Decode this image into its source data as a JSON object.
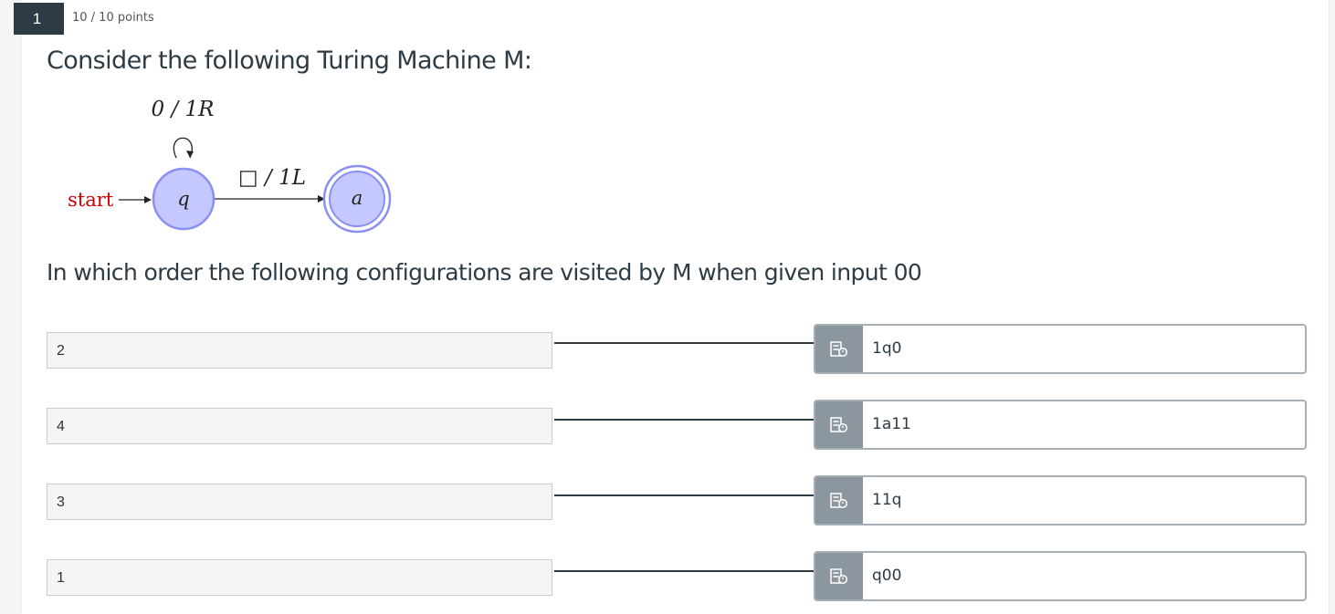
{
  "question": {
    "number": "1",
    "points": "10 / 10 points",
    "title": "Consider the following Turing Machine M:",
    "prompt": "In which order the following configurations are visited by M when given input 00"
  },
  "diagram": {
    "start_label": "start",
    "loop_label": "0 / 1R",
    "edge_label": "□ / 1L",
    "state_q": "q",
    "state_a": "a",
    "colors": {
      "start": "#d00000",
      "state_fill": "#c5c8ff",
      "state_stroke": "#8a8ff2"
    }
  },
  "matches": [
    {
      "answer": "2",
      "option": "1q0",
      "handle_icon": "drag-handle-icon"
    },
    {
      "answer": "4",
      "option": "1a11",
      "handle_icon": "drag-handle-icon"
    },
    {
      "answer": "3",
      "option": "11q",
      "handle_icon": "drag-handle-icon"
    },
    {
      "answer": "1",
      "option": "q00",
      "handle_icon": "drag-handle-icon"
    }
  ]
}
